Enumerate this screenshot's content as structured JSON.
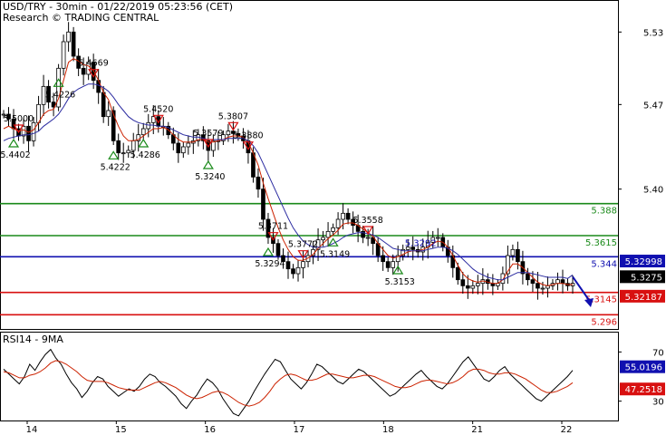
{
  "header": {
    "title": "USD/TRY - 30min - 01/22/2019 05:23:56 (CET)",
    "subtitle": "Research © TRADING CENTRAL"
  },
  "rsi_panel": {
    "title": "RSI14 - 9MA"
  },
  "colors": {
    "resistance": "#1a8a1a",
    "pivot": "#1010b0",
    "support": "#d81010",
    "price": "#000000",
    "ma_fast": "#cc2200",
    "ma_slow": "#2a2aa0",
    "rsi": "#000000",
    "rsi_ma": "#cc2200",
    "current_badge": "#000000",
    "ma_badge": "#1010b0",
    "ma2_badge": "#d81010"
  },
  "chart_data": [
    {
      "type": "line",
      "subtype": "candlestick",
      "title": "USD/TRY - 30min",
      "ylim": [
        5.285,
        5.555
      ],
      "y_ticks": [
        5.53,
        5.47,
        5.4
      ],
      "x_tick_labels": [
        "14",
        "15",
        "16",
        "17",
        "18",
        "21",
        "22"
      ],
      "series": [
        {
          "name": "USD/TRY",
          "values": [
            5.462,
            5.458,
            5.45,
            5.444,
            5.452,
            5.44,
            5.455,
            5.47,
            5.485,
            5.472,
            5.468,
            5.5,
            5.522,
            5.53,
            5.51,
            5.5,
            5.495,
            5.505,
            5.49,
            5.48,
            5.46,
            5.465,
            5.44,
            5.43,
            5.43,
            5.432,
            5.44,
            5.445,
            5.45,
            5.455,
            5.46,
            5.452,
            5.452,
            5.445,
            5.438,
            5.43,
            5.435,
            5.438,
            5.44,
            5.445,
            5.44,
            5.432,
            5.44,
            5.44,
            5.445,
            5.448,
            5.446,
            5.444,
            5.44,
            5.43,
            5.41,
            5.4,
            5.375,
            5.36,
            5.355,
            5.345,
            5.34,
            5.334,
            5.33,
            5.335,
            5.34,
            5.345,
            5.35,
            5.358,
            5.36,
            5.365,
            5.368,
            5.375,
            5.38,
            5.375,
            5.37,
            5.365,
            5.36,
            5.36,
            5.355,
            5.345,
            5.34,
            5.335,
            5.34,
            5.345,
            5.35,
            5.352,
            5.35,
            5.348,
            5.352,
            5.356,
            5.36,
            5.36,
            5.352,
            5.345,
            5.335,
            5.325,
            5.32,
            5.318,
            5.32,
            5.322,
            5.325,
            5.322,
            5.32,
            5.322,
            5.33,
            5.345,
            5.35,
            5.34,
            5.33,
            5.325,
            5.322,
            5.318,
            5.318,
            5.32,
            5.322,
            5.325,
            5.322,
            5.32,
            5.322
          ]
        },
        {
          "name": "MA fast",
          "values": [
            5.45,
            5.452,
            5.45,
            5.448,
            5.449,
            5.447,
            5.449,
            5.455,
            5.462,
            5.465,
            5.466,
            5.475,
            5.49,
            5.505,
            5.508,
            5.506,
            5.503,
            5.502,
            5.498,
            5.49,
            5.48,
            5.474,
            5.462,
            5.452,
            5.444,
            5.44,
            5.44,
            5.441,
            5.444,
            5.447,
            5.45,
            5.45,
            5.451,
            5.449,
            5.445,
            5.441,
            5.439,
            5.439,
            5.439,
            5.441,
            5.441,
            5.439,
            5.439,
            5.44,
            5.441,
            5.443,
            5.444,
            5.444,
            5.443,
            5.439,
            5.43,
            5.42,
            5.405,
            5.392,
            5.38,
            5.368,
            5.358,
            5.35,
            5.344,
            5.341,
            5.341,
            5.343,
            5.346,
            5.351,
            5.355,
            5.359,
            5.362,
            5.366,
            5.371,
            5.372,
            5.372,
            5.37,
            5.367,
            5.364,
            5.361,
            5.355,
            5.35,
            5.345,
            5.343,
            5.344,
            5.346,
            5.348,
            5.349,
            5.349,
            5.35,
            5.352,
            5.355,
            5.357,
            5.356,
            5.352,
            5.345,
            5.337,
            5.33,
            5.326,
            5.324,
            5.323,
            5.324,
            5.323,
            5.322,
            5.322,
            5.325,
            5.332,
            5.338,
            5.338,
            5.335,
            5.331,
            5.327,
            5.323,
            5.321,
            5.32,
            5.321,
            5.322,
            5.322,
            5.321,
            5.321
          ]
        },
        {
          "name": "MA slow",
          "values": [
            5.44,
            5.442,
            5.443,
            5.444,
            5.445,
            5.445,
            5.446,
            5.448,
            5.452,
            5.455,
            5.458,
            5.462,
            5.468,
            5.475,
            5.48,
            5.483,
            5.485,
            5.487,
            5.487,
            5.486,
            5.484,
            5.481,
            5.476,
            5.47,
            5.465,
            5.46,
            5.457,
            5.455,
            5.454,
            5.453,
            5.453,
            5.452,
            5.452,
            5.451,
            5.449,
            5.447,
            5.445,
            5.444,
            5.443,
            5.443,
            5.442,
            5.441,
            5.441,
            5.441,
            5.441,
            5.442,
            5.442,
            5.442,
            5.442,
            5.44,
            5.436,
            5.43,
            5.421,
            5.412,
            5.403,
            5.394,
            5.385,
            5.376,
            5.368,
            5.362,
            5.357,
            5.354,
            5.352,
            5.352,
            5.352,
            5.353,
            5.355,
            5.357,
            5.36,
            5.362,
            5.363,
            5.364,
            5.364,
            5.363,
            5.362,
            5.36,
            5.357,
            5.354,
            5.351,
            5.35,
            5.349,
            5.349,
            5.349,
            5.349,
            5.349,
            5.35,
            5.351,
            5.352,
            5.352,
            5.351,
            5.349,
            5.346,
            5.342,
            5.338,
            5.334,
            5.331,
            5.329,
            5.327,
            5.326,
            5.325,
            5.325,
            5.327,
            5.329,
            5.331,
            5.331,
            5.331,
            5.33,
            5.329,
            5.328,
            5.327,
            5.327,
            5.327,
            5.327,
            5.326,
            5.329
          ]
        }
      ],
      "levels": [
        {
          "value": 5.388,
          "label": "5.388",
          "role": "resistance"
        },
        {
          "value": 5.3615,
          "label": "5.3615",
          "role": "resistance"
        },
        {
          "value": 5.344,
          "label": "5.344",
          "role": "pivot"
        },
        {
          "value": 5.3145,
          "label": "5.3145",
          "role": "support"
        },
        {
          "value": 5.296,
          "label": "5.296",
          "role": "support"
        }
      ],
      "annotations": [
        {
          "label": "5.5000",
          "kind": "high",
          "x_index": 3
        },
        {
          "label": "5.4402",
          "kind": "low",
          "x_index": 2
        },
        {
          "label": "5.4669",
          "kind": "high",
          "x_index": 18
        },
        {
          "label": "5.4226",
          "kind": "low",
          "x_index": 11
        },
        {
          "label": "5.4222",
          "kind": "low",
          "x_index": 22
        },
        {
          "label": "5.4520",
          "kind": "high",
          "x_index": 31
        },
        {
          "label": "5.4286",
          "kind": "low",
          "x_index": 28
        },
        {
          "label": "5.3579",
          "kind": "high",
          "x_index": 41
        },
        {
          "label": "5.3807",
          "kind": "high",
          "x_index": 46
        },
        {
          "label": "5.3880",
          "kind": "high",
          "x_index": 49
        },
        {
          "label": "5.3240",
          "kind": "low",
          "x_index": 41
        },
        {
          "label": "5.3711",
          "kind": "high",
          "x_index": 54
        },
        {
          "label": "5.3294",
          "kind": "low",
          "x_index": 53
        },
        {
          "label": "5.3772",
          "kind": "high",
          "x_index": 60
        },
        {
          "label": "5.3149",
          "kind": "low",
          "x_index": 66
        },
        {
          "label": "5.3558",
          "kind": "high",
          "x_index": 73
        },
        {
          "label": "5.3153",
          "kind": "low",
          "x_index": 79
        },
        {
          "label": "5.3292",
          "kind": "value",
          "x_index": 80
        }
      ],
      "price_badges": [
        {
          "label": "5.32998",
          "value": 5.32998,
          "role": "ma"
        },
        {
          "label": "5.3275",
          "value": 5.3275,
          "role": "current"
        },
        {
          "label": "5.32187",
          "value": 5.32187,
          "role": "ma2"
        }
      ],
      "projection": {
        "from": 5.3275,
        "to": 5.306,
        "direction": "down"
      }
    },
    {
      "type": "line",
      "title": "RSI14 - 9MA",
      "ylim": [
        15,
        85
      ],
      "y_ticks": [
        70,
        30
      ],
      "series": [
        {
          "name": "RSI14",
          "values": [
            56,
            52,
            48,
            44,
            50,
            60,
            55,
            62,
            68,
            72,
            65,
            60,
            52,
            45,
            40,
            33,
            38,
            45,
            50,
            48,
            42,
            38,
            34,
            37,
            40,
            38,
            42,
            48,
            52,
            50,
            45,
            42,
            38,
            34,
            28,
            24,
            30,
            35,
            42,
            48,
            45,
            40,
            32,
            26,
            20,
            18,
            24,
            30,
            38,
            45,
            52,
            58,
            64,
            62,
            55,
            48,
            44,
            40,
            45,
            52,
            60,
            58,
            54,
            50,
            46,
            44,
            48,
            52,
            56,
            54,
            50,
            46,
            42,
            38,
            34,
            36,
            40,
            44,
            48,
            52,
            55,
            50,
            46,
            42,
            40,
            44,
            50,
            56,
            62,
            66,
            60,
            54,
            48,
            46,
            50,
            55,
            58,
            52,
            48,
            44,
            40,
            36,
            32,
            30,
            34,
            38,
            42,
            46,
            50,
            55
          ]
        },
        {
          "name": "RSI MA",
          "values": [
            54,
            53,
            51,
            49,
            49,
            51,
            52,
            54,
            57,
            61,
            63,
            62,
            60,
            57,
            54,
            50,
            47,
            46,
            46,
            46,
            45,
            43,
            41,
            40,
            39,
            39,
            39,
            41,
            43,
            45,
            46,
            45,
            43,
            41,
            38,
            35,
            33,
            32,
            33,
            35,
            37,
            38,
            37,
            35,
            32,
            29,
            27,
            26,
            27,
            29,
            33,
            38,
            44,
            48,
            51,
            52,
            51,
            49,
            47,
            47,
            48,
            50,
            52,
            52,
            51,
            50,
            49,
            49,
            50,
            51,
            51,
            50,
            48,
            46,
            44,
            42,
            41,
            41,
            42,
            44,
            46,
            47,
            47,
            46,
            45,
            44,
            45,
            47,
            50,
            54,
            56,
            56,
            55,
            53,
            52,
            52,
            53,
            53,
            52,
            50,
            48,
            45,
            42,
            39,
            37,
            37,
            38,
            40,
            42,
            45
          ]
        }
      ],
      "badges": [
        {
          "label": "55.0196",
          "value": 55.0196,
          "role": "rsi"
        },
        {
          "label": "47.2518",
          "value": 47.2518,
          "role": "rsi_ma"
        }
      ]
    }
  ]
}
